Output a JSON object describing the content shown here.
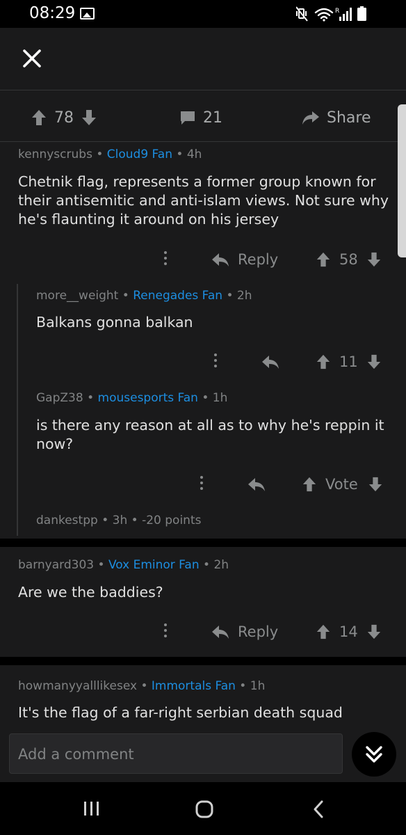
{
  "status_bar": {
    "time": "08:29"
  },
  "post_actions": {
    "upvotes": "78",
    "comments": "21",
    "share_label": "Share"
  },
  "comments": [
    {
      "user": "kennyscrubs",
      "flair": "Cloud9 Fan",
      "age": "4h",
      "text": "Chetnik flag, represents a former group known for their antisemitic and anti-islam views. Not sure why he's flaunting it around on his jersey",
      "reply_label": "Reply",
      "score": "58"
    },
    {
      "user": "more__weight",
      "flair": "Renegades Fan",
      "age": "2h",
      "text": "Balkans gonna balkan",
      "score": "11"
    },
    {
      "user": "GapZ38",
      "flair": "mousesports Fan",
      "age": "1h",
      "text": "is there any reason at all as to why he's reppin it now?",
      "score": "Vote"
    },
    {
      "user": "dankestpp",
      "age": "3h",
      "points": "-20 points"
    },
    {
      "user": "barnyard303",
      "flair": "Vox Eminor Fan",
      "age": "2h",
      "text": "Are we the baddies?",
      "reply_label": "Reply",
      "score": "14"
    },
    {
      "user": "howmanyyalllikesex",
      "flair": "Immortals Fan",
      "age": "1h",
      "text": "It's the flag of a far-right serbian death squad"
    }
  ],
  "composer": {
    "placeholder": "Add a comment"
  },
  "colors": {
    "background": "#1a1a1b",
    "flair": "#1d8ee0",
    "muted": "#818384"
  }
}
